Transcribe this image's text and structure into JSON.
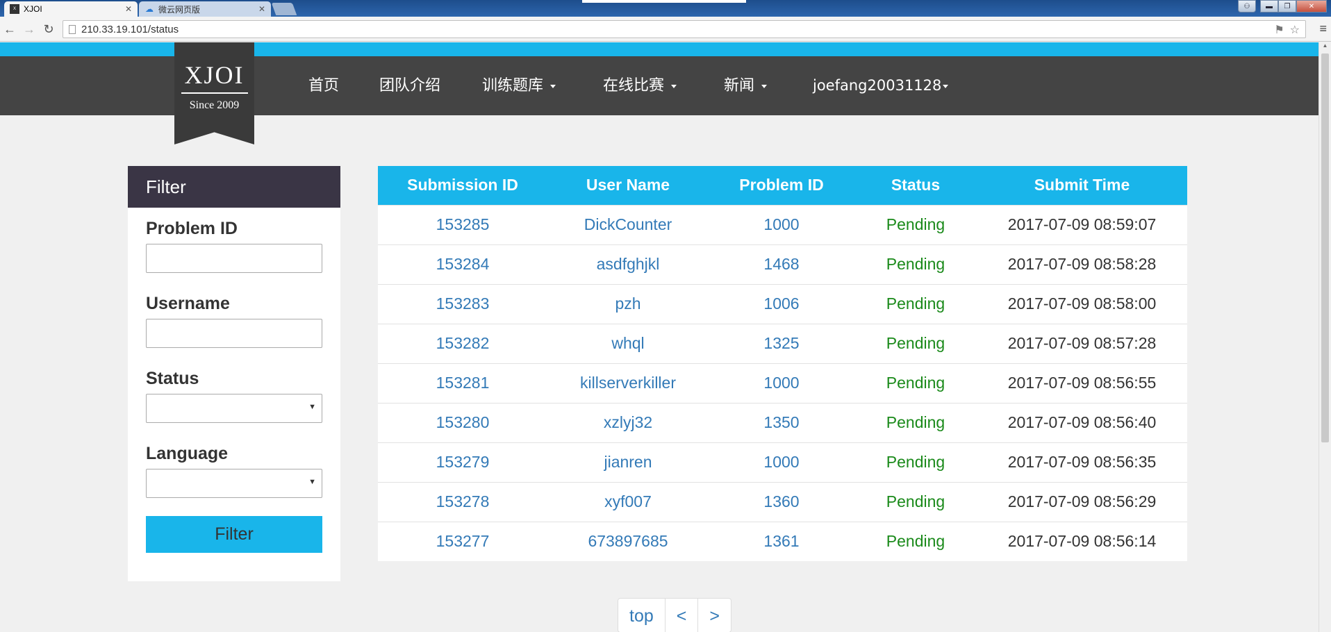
{
  "browser": {
    "tabs": [
      {
        "title": "XJOI",
        "active": true
      },
      {
        "title": "微云网页版",
        "active": false
      }
    ],
    "url": "210.33.19.101/status"
  },
  "site": {
    "logo": {
      "title": "XJOI",
      "subtitle": "Since 2009"
    },
    "nav": [
      "首页",
      "团队介绍",
      "训练题库",
      "在线比赛",
      "新闻",
      "joefang20031128"
    ],
    "accent_color": "#19b5ea",
    "navbar_color": "#444444"
  },
  "filter": {
    "header": "Filter",
    "problem_id_label": "Problem ID",
    "problem_id_value": "",
    "username_label": "Username",
    "username_value": "",
    "status_label": "Status",
    "status_value": "",
    "language_label": "Language",
    "language_value": "",
    "button": "Filter"
  },
  "table": {
    "headers": [
      "Submission ID",
      "User Name",
      "Problem ID",
      "Status",
      "Submit Time"
    ],
    "rows": [
      [
        "153285",
        "DickCounter",
        "1000",
        "Pending",
        "2017-07-09 08:59:07"
      ],
      [
        "153284",
        "asdfghjkl",
        "1468",
        "Pending",
        "2017-07-09 08:58:28"
      ],
      [
        "153283",
        "pzh",
        "1006",
        "Pending",
        "2017-07-09 08:58:00"
      ],
      [
        "153282",
        "whql",
        "1325",
        "Pending",
        "2017-07-09 08:57:28"
      ],
      [
        "153281",
        "killserverkiller",
        "1000",
        "Pending",
        "2017-07-09 08:56:55"
      ],
      [
        "153280",
        "xzlyj32",
        "1350",
        "Pending",
        "2017-07-09 08:56:40"
      ],
      [
        "153279",
        "jianren",
        "1000",
        "Pending",
        "2017-07-09 08:56:35"
      ],
      [
        "153278",
        "xyf007",
        "1360",
        "Pending",
        "2017-07-09 08:56:29"
      ],
      [
        "153277",
        "673897685",
        "1361",
        "Pending",
        "2017-07-09 08:56:14"
      ]
    ]
  },
  "pagination": [
    "top",
    "<",
    ">"
  ]
}
